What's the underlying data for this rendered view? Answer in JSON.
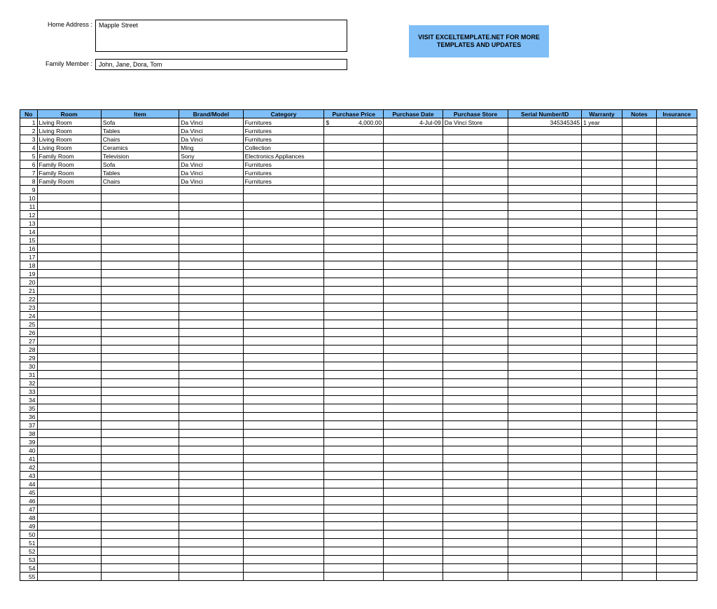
{
  "labels": {
    "home_address": "Home Address :",
    "family_member": "Family Member :"
  },
  "fields": {
    "home_address": "Mapple Street",
    "family_member": "John, Jane, Dora, Tom"
  },
  "promo": "VISIT EXCELTEMPLATE.NET FOR MORE TEMPLATES AND UPDATES",
  "columns": {
    "no": "No",
    "room": "Room",
    "item": "Item",
    "brand": "Brand/Model",
    "category": "Category",
    "price": "Purchase Price",
    "date": "Purchase Date",
    "store": "Purchase Store",
    "serial": "Serial Number/ID",
    "warranty": "Warranty",
    "notes": "Notes",
    "insurance": "Insurance"
  },
  "total_rows": 55,
  "rows": [
    {
      "no": "1",
      "room": "Living Room",
      "item": "Sofa",
      "brand": "Da Vinci",
      "category": "Furnitures",
      "price_currency": "$",
      "price_value": "4,000.00",
      "date": "4-Jul-09",
      "store": "Da Vinci Store",
      "serial": "345345345",
      "warranty": "1 year",
      "notes": "",
      "insurance": ""
    },
    {
      "no": "2",
      "room": "Living Room",
      "item": "Tables",
      "brand": "Da Vinci",
      "category": "Furnitures",
      "price_currency": "",
      "price_value": "",
      "date": "",
      "store": "",
      "serial": "",
      "warranty": "",
      "notes": "",
      "insurance": ""
    },
    {
      "no": "3",
      "room": "Living Room",
      "item": "Chairs",
      "brand": "Da Vinci",
      "category": "Furnitures",
      "price_currency": "",
      "price_value": "",
      "date": "",
      "store": "",
      "serial": "",
      "warranty": "",
      "notes": "",
      "insurance": ""
    },
    {
      "no": "4",
      "room": "Living Room",
      "item": "Ceramics",
      "brand": "Ming",
      "category": "Collection",
      "price_currency": "",
      "price_value": "",
      "date": "",
      "store": "",
      "serial": "",
      "warranty": "",
      "notes": "",
      "insurance": ""
    },
    {
      "no": "5",
      "room": "Family Room",
      "item": "Television",
      "brand": "Sony",
      "category": "Electronics Appliances",
      "price_currency": "",
      "price_value": "",
      "date": "",
      "store": "",
      "serial": "",
      "warranty": "",
      "notes": "",
      "insurance": ""
    },
    {
      "no": "6",
      "room": "Family Room",
      "item": "Sofa",
      "brand": "Da Vinci",
      "category": "Furnitures",
      "price_currency": "",
      "price_value": "",
      "date": "",
      "store": "",
      "serial": "",
      "warranty": "",
      "notes": "",
      "insurance": ""
    },
    {
      "no": "7",
      "room": "Family Room",
      "item": "Tables",
      "brand": "Da Vinci",
      "category": "Furnitures",
      "price_currency": "",
      "price_value": "",
      "date": "",
      "store": "",
      "serial": "",
      "warranty": "",
      "notes": "",
      "insurance": ""
    },
    {
      "no": "8",
      "room": "Family Room",
      "item": "Chairs",
      "brand": "Da Vinci",
      "category": "Furnitures",
      "price_currency": "",
      "price_value": "",
      "date": "",
      "store": "",
      "serial": "",
      "warranty": "",
      "notes": "",
      "insurance": ""
    }
  ]
}
